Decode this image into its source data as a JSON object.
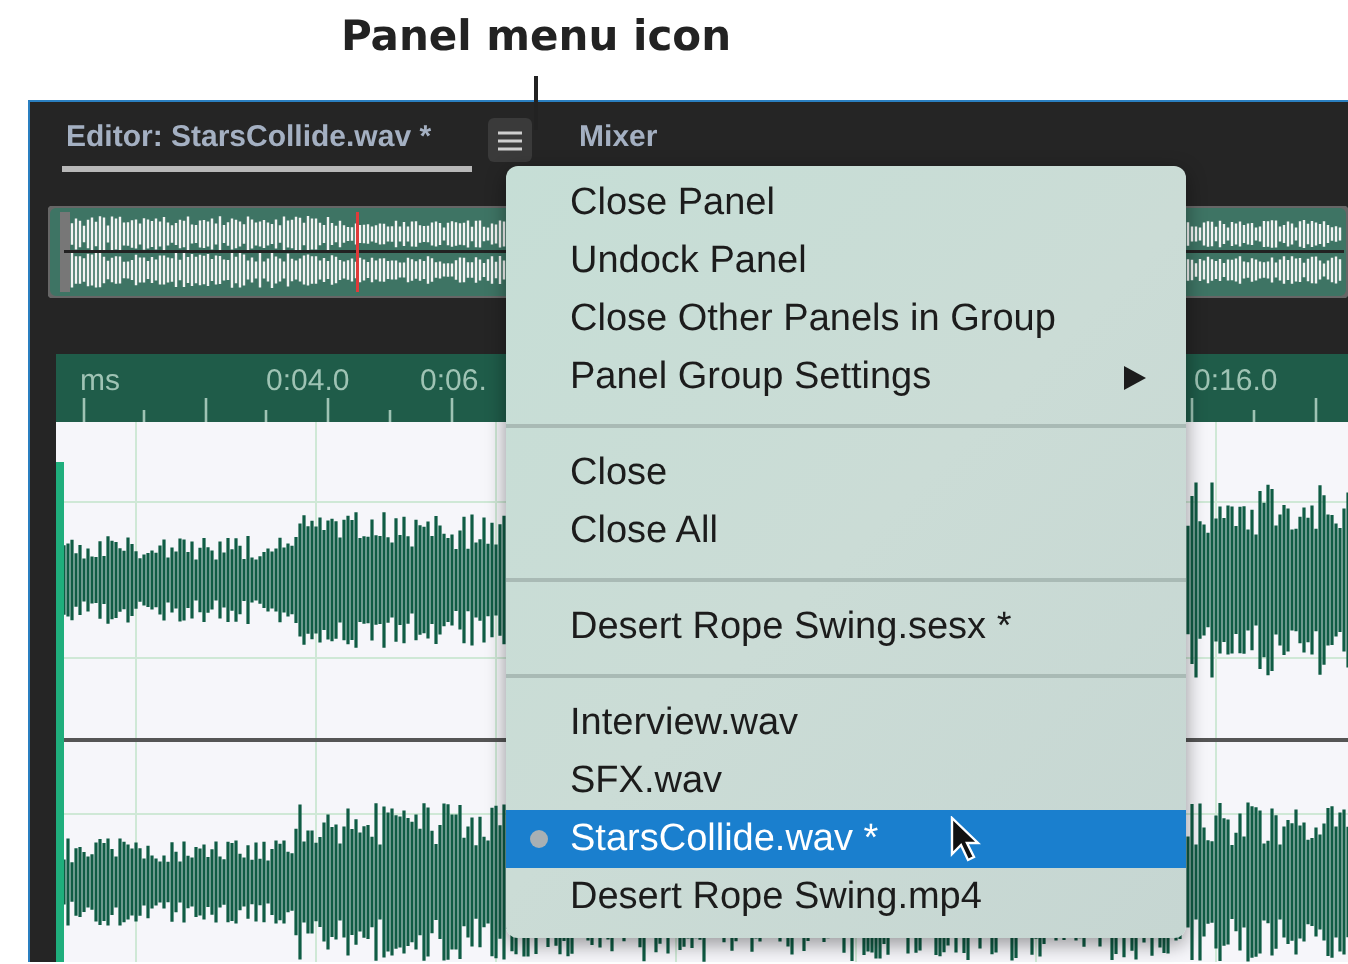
{
  "annotation": {
    "caption": "Panel menu icon"
  },
  "tabs": [
    {
      "label": "Editor: StarsCollide.wav *",
      "selected": true
    },
    {
      "label": "Mixer",
      "selected": false
    }
  ],
  "ruler": {
    "labels": [
      "ms",
      "0:04.0",
      "0:06.",
      "0:16.0"
    ]
  },
  "menu": {
    "groups": [
      {
        "items": [
          {
            "label": "Close Panel",
            "selected": false,
            "submenu": false
          },
          {
            "label": "Undock Panel",
            "selected": false,
            "submenu": false
          },
          {
            "label": "Close Other Panels in Group",
            "selected": false,
            "submenu": false
          },
          {
            "label": "Panel Group Settings",
            "selected": false,
            "submenu": true
          }
        ]
      },
      {
        "items": [
          {
            "label": "Close",
            "selected": false,
            "submenu": false
          },
          {
            "label": "Close All",
            "selected": false,
            "submenu": false
          }
        ]
      },
      {
        "items": [
          {
            "label": "Desert Rope Swing.sesx *",
            "selected": false,
            "submenu": false
          }
        ]
      },
      {
        "items": [
          {
            "label": "Interview.wav",
            "selected": false,
            "submenu": false,
            "current": false
          },
          {
            "label": "SFX.wav",
            "selected": false,
            "submenu": false,
            "current": false
          },
          {
            "label": "StarsCollide.wav *",
            "selected": true,
            "submenu": false,
            "current": true
          },
          {
            "label": "Desert Rope Swing.mp4",
            "selected": false,
            "submenu": false,
            "current": false
          }
        ]
      }
    ]
  }
}
